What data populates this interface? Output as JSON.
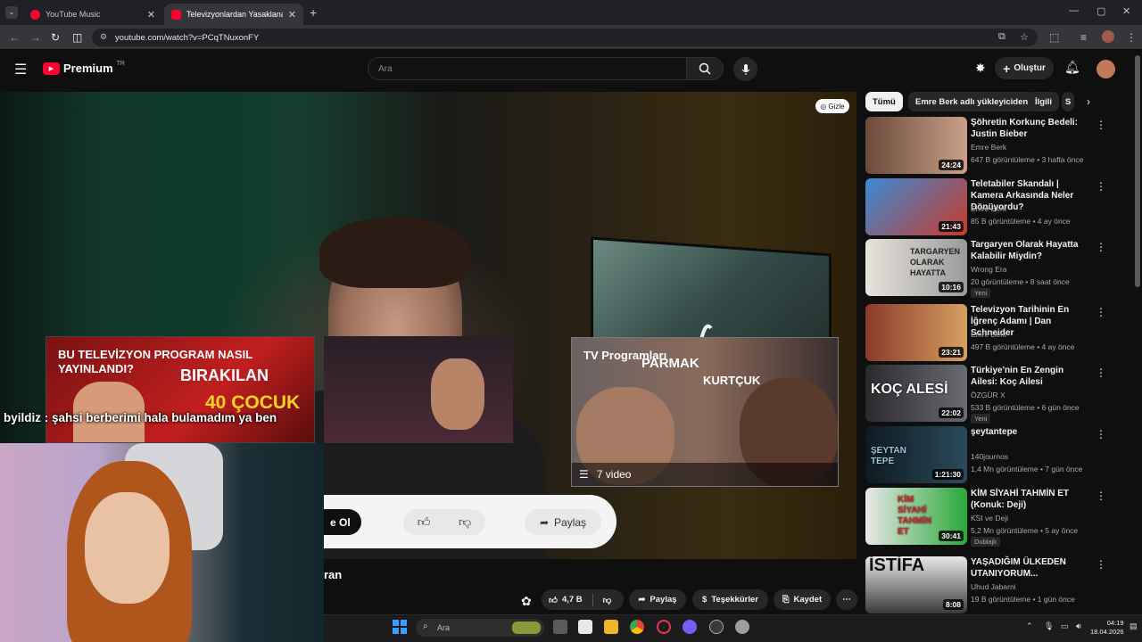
{
  "tabs": [
    {
      "label": "YouTube Music",
      "favicon_color": "#ff0033"
    },
    {
      "label": "Televizyonlardan Yasaklanan Gü",
      "favicon_color": "#ff0033"
    }
  ],
  "address": {
    "url": "youtube.com/watch?v=PCqTNuxonFY"
  },
  "header": {
    "logo": "Premium",
    "region": "TR",
    "search_placeholder": "Ara",
    "create_label": "Oluştur"
  },
  "player": {
    "hide_label": "Gizle",
    "left_card": {
      "line1": "BU TELEVİZYON PROGRAM NASIL",
      "line2": "YAYINLANDI?",
      "word1": "BIRAKILAN",
      "word2": "40 ÇOCUK"
    },
    "chat_overlay": "byildiz : şahsi berberimi hala bulamadım ya ben",
    "right_card": {
      "title": "TV Programları",
      "word1": "PARMAK",
      "word2": "KURTÇUK",
      "count": "7 video"
    },
    "pill": {
      "subscribe": "e Ol",
      "share": "Paylaş"
    },
    "partial_text": "ran"
  },
  "actions": {
    "likes": "4,7 B",
    "share": "Paylaş",
    "thanks": "Teşekkürler",
    "save": "Kaydet"
  },
  "chips": [
    "Tümü",
    "Emre Berk adlı yükleyiciden",
    "İlgili",
    "S"
  ],
  "recommendations": [
    {
      "title": "Şöhretin Korkunç Bedeli: Justin Bieber",
      "channel": "Emre Berk",
      "meta": "647 B görüntüleme • 3 hafta önce",
      "duration": "24:24",
      "thumb_text": "",
      "badge": "",
      "colors": [
        "#6a4a3a",
        "#c9a088"
      ]
    },
    {
      "title": "Teletabiler Skandalı | Kamera Arkasında Neler Dönüyordu?",
      "channel": "Emre Berk",
      "meta": "85 B görüntüleme • 4 ay önce",
      "duration": "21:43",
      "thumb_text": "",
      "badge": "",
      "colors": [
        "#3a8ad6",
        "#c83a2a"
      ]
    },
    {
      "title": "Targaryen Olarak Hayatta Kalabilir Miydin?",
      "channel": "Wrong Era",
      "meta": "20 görüntüleme • 8 saat önce",
      "duration": "10:16",
      "thumb_text": "TARGARYEN OLARAK HAYATTA",
      "badge": "Yeni",
      "colors": [
        "#e8e4dc",
        "#9a9a9a"
      ]
    },
    {
      "title": "Televizyon Tarihinin En İğrenç Adamı | Dan Schneider",
      "channel": "Emre Berk",
      "meta": "497 B görüntüleme • 4 ay önce",
      "duration": "23:21",
      "thumb_text": "",
      "badge": "",
      "colors": [
        "#8a3a2a",
        "#d6a060"
      ]
    },
    {
      "title": "Türkiye'nin En Zengin Ailesi: Koç Ailesi",
      "channel": "ÖZGÜR X",
      "meta": "533 B görüntüleme • 6 gün önce",
      "duration": "22:02",
      "thumb_text": "KOÇ ALESİ",
      "badge": "Yeni",
      "colors": [
        "#2a2a2e",
        "#6a6a72"
      ]
    },
    {
      "title": "şeytantepe",
      "channel": "140journos",
      "meta": "1,4 Mn görüntüleme • 7 gün önce",
      "duration": "1:21:30",
      "thumb_text": "ŞEYTAN TEPE",
      "badge": "",
      "colors": [
        "#0e1a22",
        "#2a4a5a"
      ]
    },
    {
      "title": "KİM SİYAHİ TAHMİN ET (Konuk: Deji)",
      "channel": "KSI ve Deji",
      "meta": "5,2 Mn görüntüleme • 5 ay önce",
      "duration": "30:41",
      "thumb_text": "KİM SİYAHİ TAHMİN ET",
      "badge": "Dublajlı",
      "colors": [
        "#2aa83a",
        "#e8e8e8"
      ]
    },
    {
      "title": "YAŞADIĞIM ÜLKEDEN UTANIYORUM...",
      "channel": "Uhud Jabarni",
      "meta": "19 B görüntüleme • 1 gün önce",
      "duration": "8:08",
      "thumb_text": "İSTİFA",
      "badge": "Yeni",
      "colors": [
        "#e8e8e8",
        "#3a3a3a"
      ]
    }
  ],
  "taskbar": {
    "search_placeholder": "Ara",
    "time": "04:19",
    "date": "18.04.2026"
  }
}
